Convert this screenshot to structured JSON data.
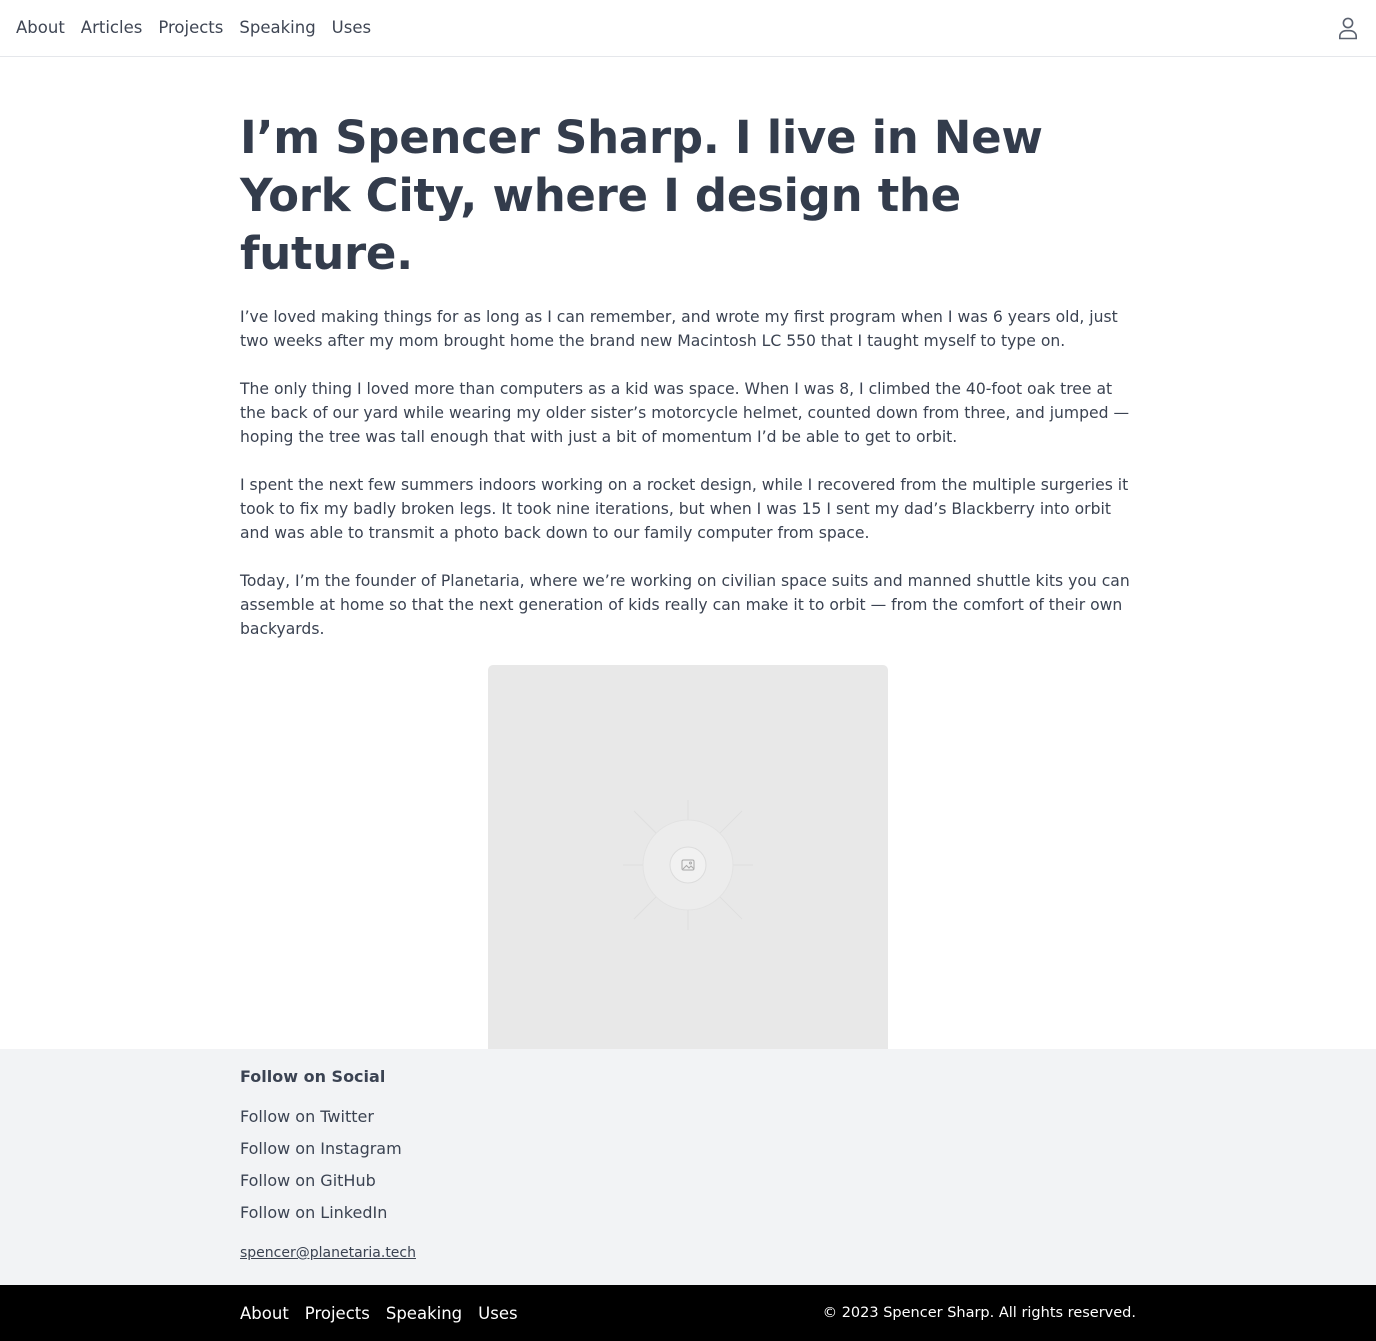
{
  "topnav": {
    "links": [
      "About",
      "Articles",
      "Projects",
      "Speaking",
      "Uses"
    ],
    "user_icon": "user-icon"
  },
  "main": {
    "title": "I’m Spencer Sharp. I live in New York City, where I design the future.",
    "paragraphs": [
      "I’ve loved making things for as long as I can remember, and wrote my first program when I was 6 years old, just two weeks after my mom brought home the brand new Macintosh LC 550 that I taught myself to type on.",
      "The only thing I loved more than computers as a kid was space. When I was 8, I climbed the 40-foot oak tree at the back of our yard while wearing my older sister’s motorcycle helmet, counted down from three, and jumped — hoping the tree was tall enough that with just a bit of momentum I’d be able to get to orbit.",
      "I spent the next few summers indoors working on a rocket design, while I recovered from the multiple surgeries it took to fix my badly broken legs. It took nine iterations, but when I was 15 I sent my dad’s Blackberry into orbit and was able to transmit a photo back down to our family computer from space.",
      "Today, I’m the founder of Planetaria, where we’re working on civilian space suits and manned shuttle kits you can assemble at home so that the next generation of kids really can make it to orbit — from the comfort of their own backyards."
    ],
    "photo_icon": "image-placeholder-icon"
  },
  "social": {
    "heading": "Follow on Social",
    "links": [
      "Follow on Twitter",
      "Follow on Instagram",
      "Follow on GitHub",
      "Follow on LinkedIn"
    ],
    "email": "spencer@planetaria.tech"
  },
  "footer": {
    "links": [
      "About",
      "Projects",
      "Speaking",
      "Uses"
    ],
    "copyright": "© 2023 Spencer Sharp. All rights reserved."
  },
  "colors": {
    "text": "#3b4352",
    "heading": "#333c4c",
    "social_bg": "#f2f3f5",
    "footer_bg": "#000000",
    "photo_bg": "#e8e8e8"
  }
}
